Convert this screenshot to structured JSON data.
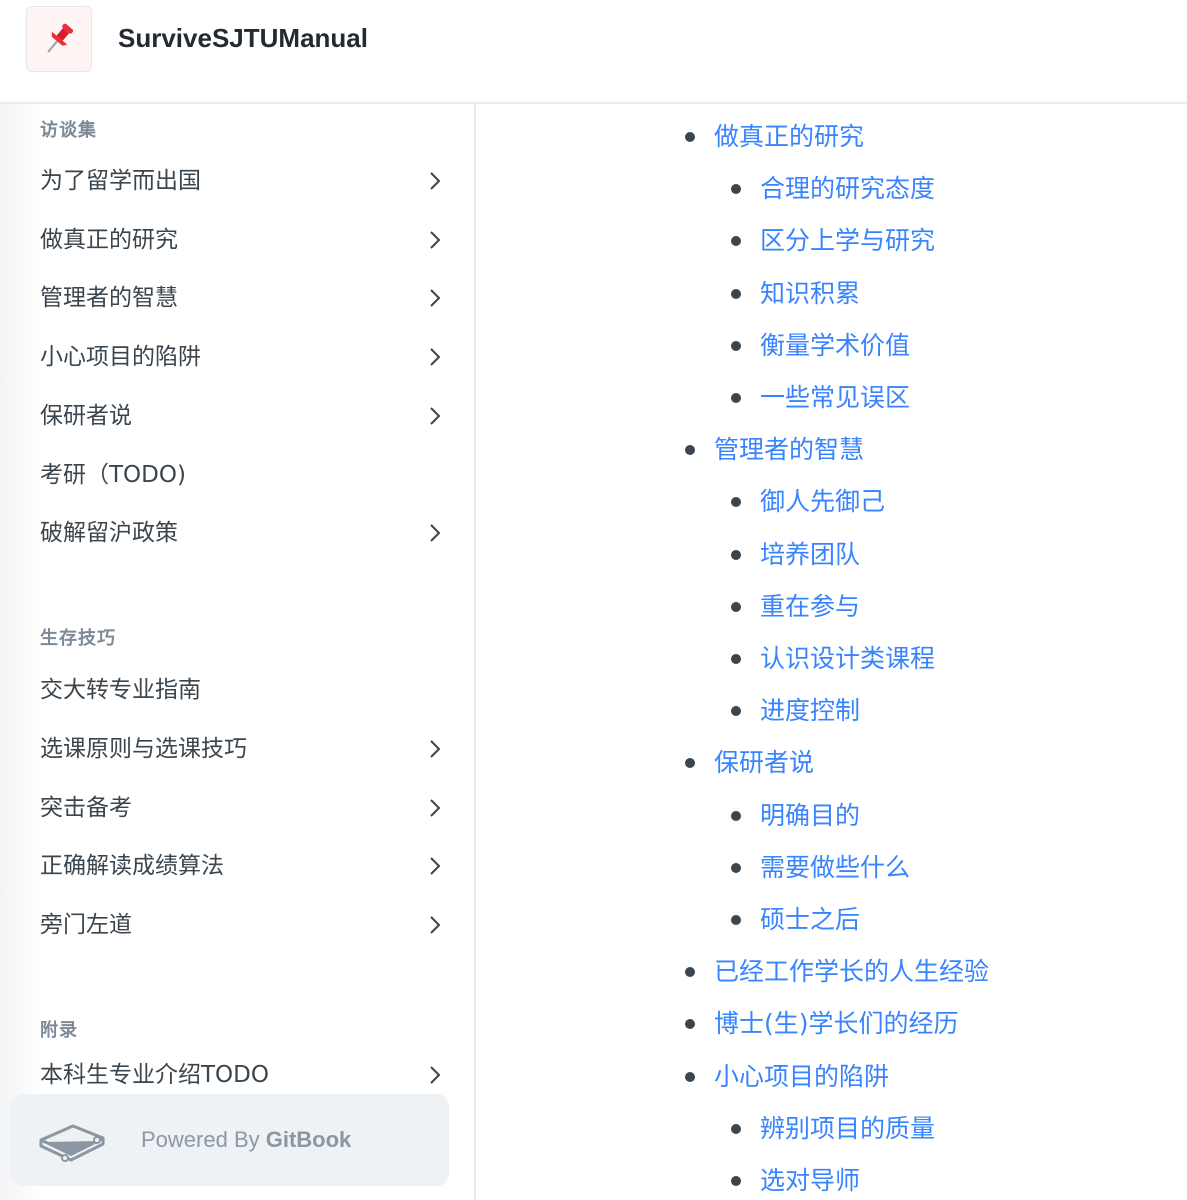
{
  "header": {
    "title": "SurviveSJTUManual",
    "logo_icon": "pushpin-icon"
  },
  "sidebar": {
    "sections": [
      {
        "title": "访谈集",
        "items": [
          {
            "label": "为了留学而出国",
            "expandable": true
          },
          {
            "label": "做真正的研究",
            "expandable": true
          },
          {
            "label": "管理者的智慧",
            "expandable": true
          },
          {
            "label": "小心项目的陷阱",
            "expandable": true
          },
          {
            "label": "保研者说",
            "expandable": true
          },
          {
            "label": "考研（TODO)",
            "expandable": false
          },
          {
            "label": "破解留沪政策",
            "expandable": true
          }
        ]
      },
      {
        "title": "生存技巧",
        "items": [
          {
            "label": "交大转专业指南",
            "expandable": false
          },
          {
            "label": "选课原则与选课技巧",
            "expandable": true
          },
          {
            "label": "突击备考",
            "expandable": true
          },
          {
            "label": "正确解读成绩算法",
            "expandable": true
          },
          {
            "label": "旁门左道",
            "expandable": true
          }
        ]
      },
      {
        "title": "附录",
        "items": [
          {
            "label": "本科生专业介绍TODO",
            "expandable": true
          }
        ]
      }
    ],
    "powered_prefix": "Powered By ",
    "powered_brand": "GitBook"
  },
  "toc": [
    {
      "label": "做真正的研究",
      "level": 1
    },
    {
      "label": "合理的研究态度",
      "level": 2
    },
    {
      "label": "区分上学与研究",
      "level": 2
    },
    {
      "label": "知识积累",
      "level": 2
    },
    {
      "label": "衡量学术价值",
      "level": 2
    },
    {
      "label": "一些常见误区",
      "level": 2
    },
    {
      "label": "管理者的智慧",
      "level": 1
    },
    {
      "label": "御人先御己",
      "level": 2
    },
    {
      "label": "培养团队",
      "level": 2
    },
    {
      "label": "重在参与",
      "level": 2
    },
    {
      "label": "认识设计类课程",
      "level": 2
    },
    {
      "label": "进度控制",
      "level": 2
    },
    {
      "label": "保研者说",
      "level": 1
    },
    {
      "label": "明确目的",
      "level": 2
    },
    {
      "label": "需要做些什么",
      "level": 2
    },
    {
      "label": "硕士之后",
      "level": 2
    },
    {
      "label": "已经工作学长的人生经验",
      "level": 1
    },
    {
      "label": "博士(生)学长们的经历",
      "level": 1
    },
    {
      "label": "小心项目的陷阱",
      "level": 1
    },
    {
      "label": "辨别项目的质量",
      "level": 2
    },
    {
      "label": "选对导师",
      "level": 2
    }
  ],
  "colors": {
    "link": "#3884ff",
    "text": "#3b454e",
    "section": "#7d8a97"
  }
}
